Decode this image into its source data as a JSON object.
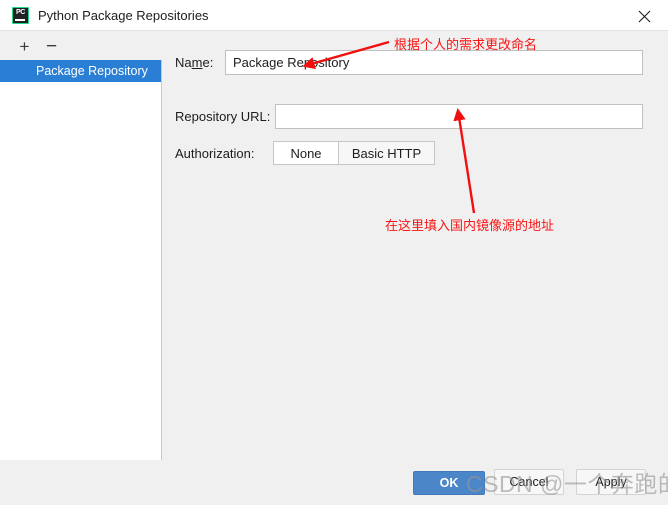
{
  "window": {
    "title": "Python Package Repositories",
    "icon": "pycharm-icon",
    "icon_text": "PC",
    "close_label": "×"
  },
  "sidebar": {
    "add_label": "+",
    "remove_label": "−",
    "items": [
      {
        "label": "Package Repository",
        "selected": true
      }
    ]
  },
  "form": {
    "name": {
      "label_prefix": "Na",
      "label_mnemonic": "m",
      "label_suffix": "e:",
      "value": "Package Repository",
      "placeholder": ""
    },
    "repository_url": {
      "label": "Repository URL:",
      "value": "",
      "placeholder": ""
    },
    "authorization": {
      "label": "Authorization:",
      "options": [
        "None",
        "Basic HTTP"
      ],
      "selected": "None"
    }
  },
  "footer": {
    "ok_label": "OK",
    "cancel_label": "Cancel",
    "apply_label": "Apply"
  },
  "annotations": {
    "color": "#fa1414",
    "name_note": "根据个人的需求更改命名",
    "url_note": "在这里填入国内镜像源的地址"
  },
  "watermark": {
    "text": "CSDN @一个奔跑的C"
  },
  "colors": {
    "accent": "#4a86c8",
    "selection": "#2a7fd4",
    "dialog_bg": "#f0f0f0",
    "annotation_red": "#fa1414"
  }
}
